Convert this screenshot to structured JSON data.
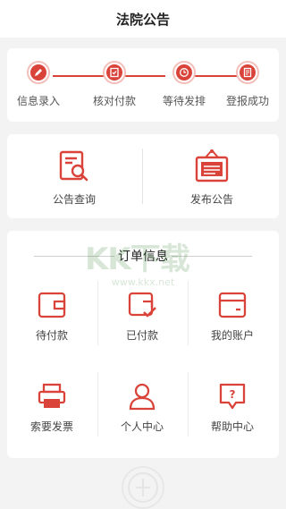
{
  "header": {
    "title": "法院公告"
  },
  "steps": [
    {
      "label": "信息录入",
      "icon": "pen-icon"
    },
    {
      "label": "核对付款",
      "icon": "checklist-icon"
    },
    {
      "label": "等待发排",
      "icon": "clock-icon"
    },
    {
      "label": "登报成功",
      "icon": "document-check-icon"
    }
  ],
  "announce": {
    "query_label": "公告查询",
    "publish_label": "发布公告"
  },
  "orders": {
    "title": "订单信息",
    "items": [
      {
        "label": "待付款",
        "icon": "wallet-icon"
      },
      {
        "label": "已付款",
        "icon": "wallet-check-icon"
      },
      {
        "label": "我的账户",
        "icon": "card-icon"
      },
      {
        "label": "索要发票",
        "icon": "printer-icon"
      },
      {
        "label": "个人中心",
        "icon": "person-icon"
      },
      {
        "label": "帮助中心",
        "icon": "help-icon"
      }
    ]
  },
  "watermark": {
    "text": "KK下载",
    "url": "www.kkx.net"
  },
  "colors": {
    "accent": "#d9433a",
    "background": "#f3f3f3"
  }
}
